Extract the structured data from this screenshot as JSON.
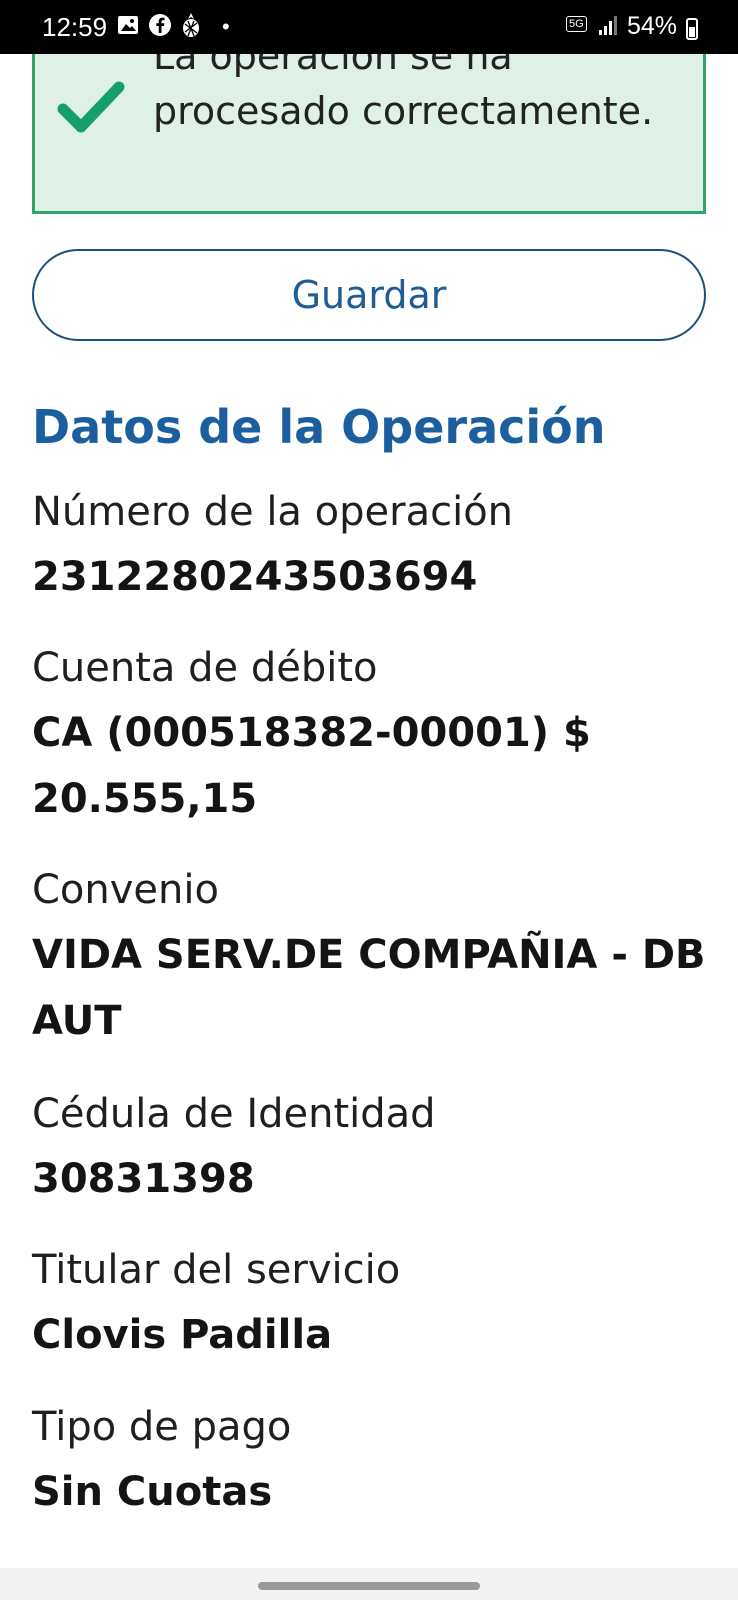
{
  "status_bar": {
    "time": "12:59",
    "net_label": "5G",
    "battery": "54%",
    "battery_level": 0.54,
    "icons": [
      "image-icon",
      "facebook-icon",
      "pineapple-icon",
      "notification-dot-icon",
      "5g-icon",
      "signal-icon",
      "battery-icon"
    ]
  },
  "banner": {
    "message": "La operación se ha procesado correctamente.",
    "icon": "check-icon",
    "accent": "#2ea569",
    "background": "#dff1e7"
  },
  "actions": {
    "save_label": "Guardar"
  },
  "section": {
    "title": "Datos de la Operación",
    "accent": "#1c5f9e"
  },
  "fields": [
    {
      "label": "Número de la operación",
      "value": "2312280243503694"
    },
    {
      "label": "Cuenta de débito",
      "value": "CA (000518382-00001) $ 20.555,15"
    },
    {
      "label": "Convenio",
      "value": "VIDA SERV.DE COMPAÑIA - DB AUT"
    },
    {
      "label": "Cédula de Identidad",
      "value": "30831398"
    },
    {
      "label": "Titular del servicio",
      "value": "Clovis Padilla"
    },
    {
      "label": "Tipo de pago",
      "value": "Sin Cuotas"
    }
  ]
}
